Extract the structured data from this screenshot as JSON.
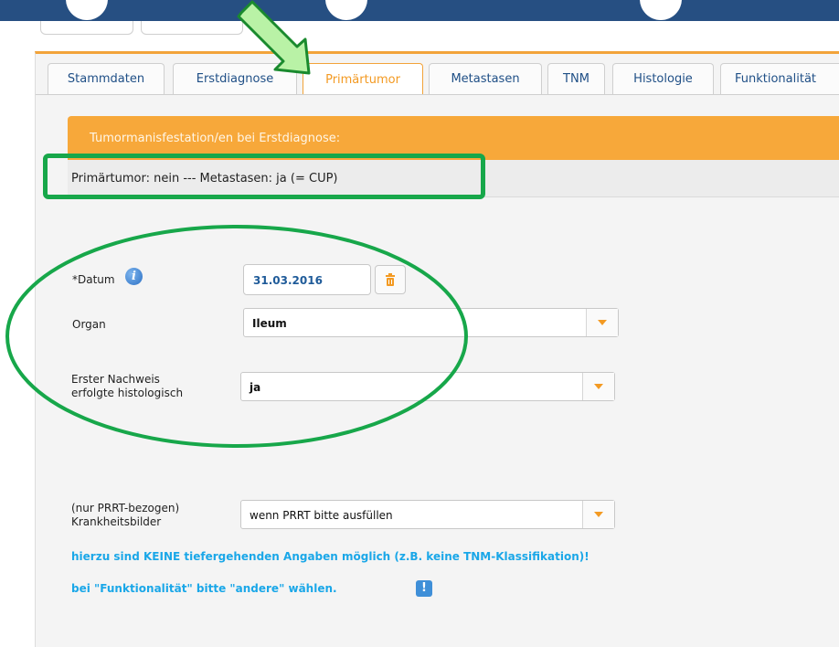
{
  "tabs": [
    {
      "label": "Stammdaten",
      "active": false
    },
    {
      "label": "Erstdiagnose",
      "active": false
    },
    {
      "label": "Primärtumor",
      "active": true
    },
    {
      "label": "Metastasen",
      "active": false
    },
    {
      "label": "TNM",
      "active": false
    },
    {
      "label": "Histologie",
      "active": false
    },
    {
      "label": "Funktionalität",
      "active": false
    }
  ],
  "panel": {
    "header": "Tumormanisfestation/en bei Erstdiagnose:",
    "summary": "Primärtumor: nein --- Metastasen: ja (= CUP)"
  },
  "form": {
    "datum_label": "*Datum",
    "datum_value": "31.03.2016",
    "organ_label": "Organ",
    "organ_value": "Ileum",
    "nachweis_label_line1": "Erster Nachweis",
    "nachweis_label_line2": "erfolgte histologisch",
    "nachweis_value": "ja",
    "prrt_label_line1": "(nur PRRT-bezogen)",
    "prrt_label_line2": "Krankheitsbilder",
    "prrt_value": "wenn PRRT bitte ausfüllen"
  },
  "notes": {
    "line1": "hierzu sind KEINE tiefergehenden Angaben möglich (z.B. keine TNM-Klassifikation)!",
    "line2": "bei \"Funktionalität\" bitte \"andere\" wählen."
  },
  "icons": {
    "info": "info-icon",
    "trash": "trash-icon",
    "dropdown": "chevron-down-icon",
    "warning": "exclamation-icon"
  },
  "colors": {
    "accent_orange": "#f7a83a",
    "tab_text": "#1f4f86",
    "annotation_green": "#17a74a",
    "note_blue": "#1aa7e8",
    "top_bar": "#264f82"
  }
}
